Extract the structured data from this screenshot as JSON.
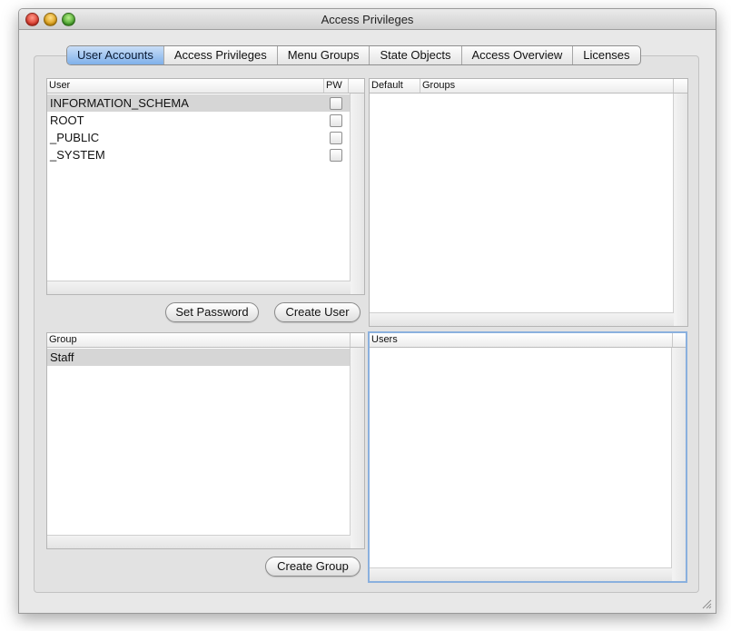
{
  "window": {
    "title": "Access Privileges"
  },
  "tabs": [
    {
      "label": "User Accounts",
      "selected": true
    },
    {
      "label": "Access Privileges"
    },
    {
      "label": "Menu Groups"
    },
    {
      "label": "State Objects"
    },
    {
      "label": "Access Overview"
    },
    {
      "label": "Licenses"
    }
  ],
  "users_table": {
    "headers": {
      "user": "User",
      "pw": "PW"
    },
    "rows": [
      {
        "name": "INFORMATION_SCHEMA",
        "pw": false,
        "selected": true
      },
      {
        "name": "ROOT",
        "pw": false
      },
      {
        "name": "_PUBLIC",
        "pw": false
      },
      {
        "name": "_SYSTEM",
        "pw": false
      }
    ]
  },
  "groups_table": {
    "headers": {
      "default": "Default",
      "groups": "Groups"
    },
    "rows": []
  },
  "buttons": {
    "set_password": "Set Password",
    "create_user": "Create User",
    "create_group": "Create Group"
  },
  "group_table": {
    "headers": {
      "group": "Group"
    },
    "rows": [
      {
        "name": "Staff",
        "selected": true
      }
    ]
  },
  "members_table": {
    "headers": {
      "users": "Users"
    },
    "rows": []
  },
  "colors": {
    "selected_tab": "#7fb0ea",
    "selected_row": "#d6d6d6",
    "focus_ring": "#8ab0de"
  }
}
